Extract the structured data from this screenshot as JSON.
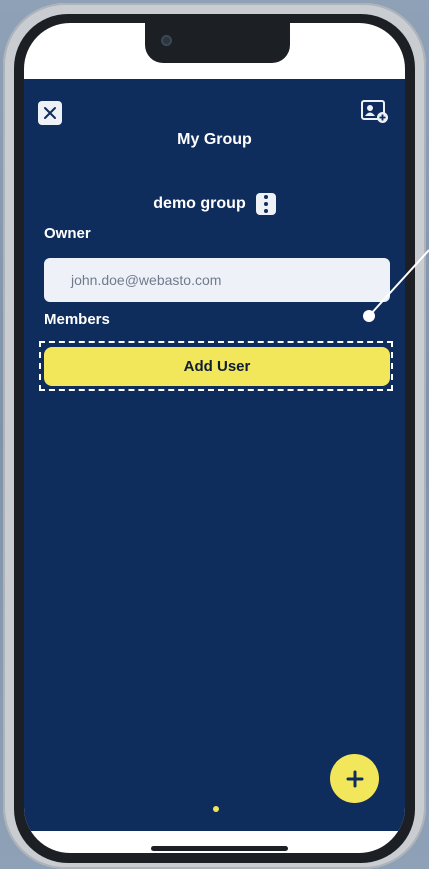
{
  "header": {
    "close_icon": "close-icon",
    "add_member_icon": "add-contact-icon",
    "title": "My Group"
  },
  "group": {
    "name": "demo group",
    "menu_icon": "kebab-menu-icon"
  },
  "owner": {
    "label": "Owner",
    "email": "john.doe@webasto.com"
  },
  "members": {
    "label": "Members",
    "add_user_label": "Add User"
  },
  "fab": {
    "icon": "plus-icon",
    "symbol": "+"
  },
  "colors": {
    "background": "#0f2d5c",
    "accent": "#f2e65a",
    "input_bg": "#eef2f8"
  }
}
